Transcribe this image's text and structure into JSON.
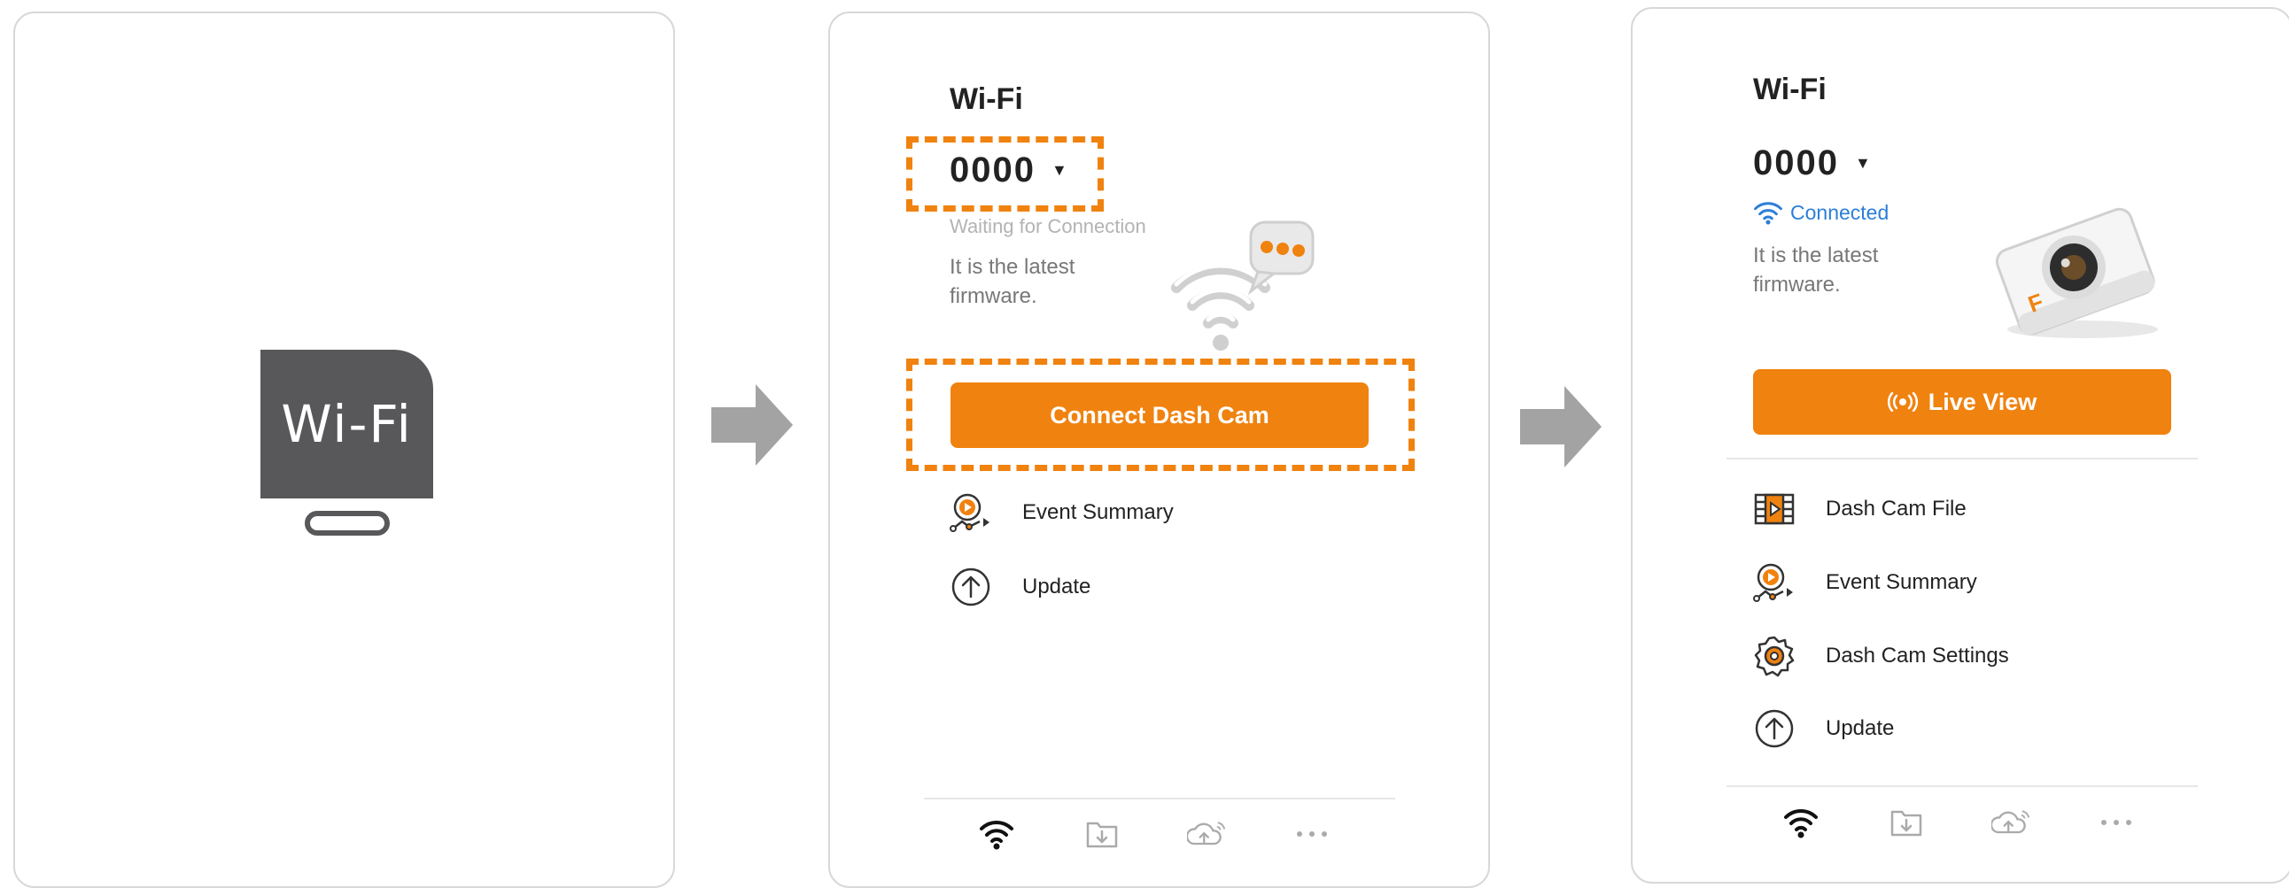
{
  "panel1": {
    "tile_text": "Wi-Fi"
  },
  "panel2": {
    "title": "Wi-Fi",
    "device_name": "0000",
    "status": "Waiting for Connection",
    "firmware_text": "It is the latest firmware.",
    "connect_button": "Connect Dash Cam",
    "menu": [
      {
        "label": "Event Summary",
        "icon": "event-summary-icon"
      },
      {
        "label": "Update",
        "icon": "update-icon"
      }
    ],
    "tabs": [
      "wifi-icon",
      "download-folder-icon",
      "cloud-upload-icon",
      "more-icon"
    ]
  },
  "panel3": {
    "title": "Wi-Fi",
    "device_name": "0000",
    "status": "Connected",
    "firmware_text": "It is the latest firmware.",
    "live_button": "Live View",
    "menu": [
      {
        "label": "Dash Cam File",
        "icon": "film-icon"
      },
      {
        "label": "Event Summary",
        "icon": "event-summary-icon"
      },
      {
        "label": "Dash Cam Settings",
        "icon": "settings-gear-icon"
      },
      {
        "label": "Update",
        "icon": "update-icon"
      }
    ],
    "tabs": [
      "wifi-icon",
      "download-folder-icon",
      "cloud-upload-icon",
      "more-icon"
    ]
  },
  "colors": {
    "accent": "#f0820f",
    "connected": "#2c7fd8",
    "tile": "#58585a",
    "arrow": "#a3a3a3"
  }
}
